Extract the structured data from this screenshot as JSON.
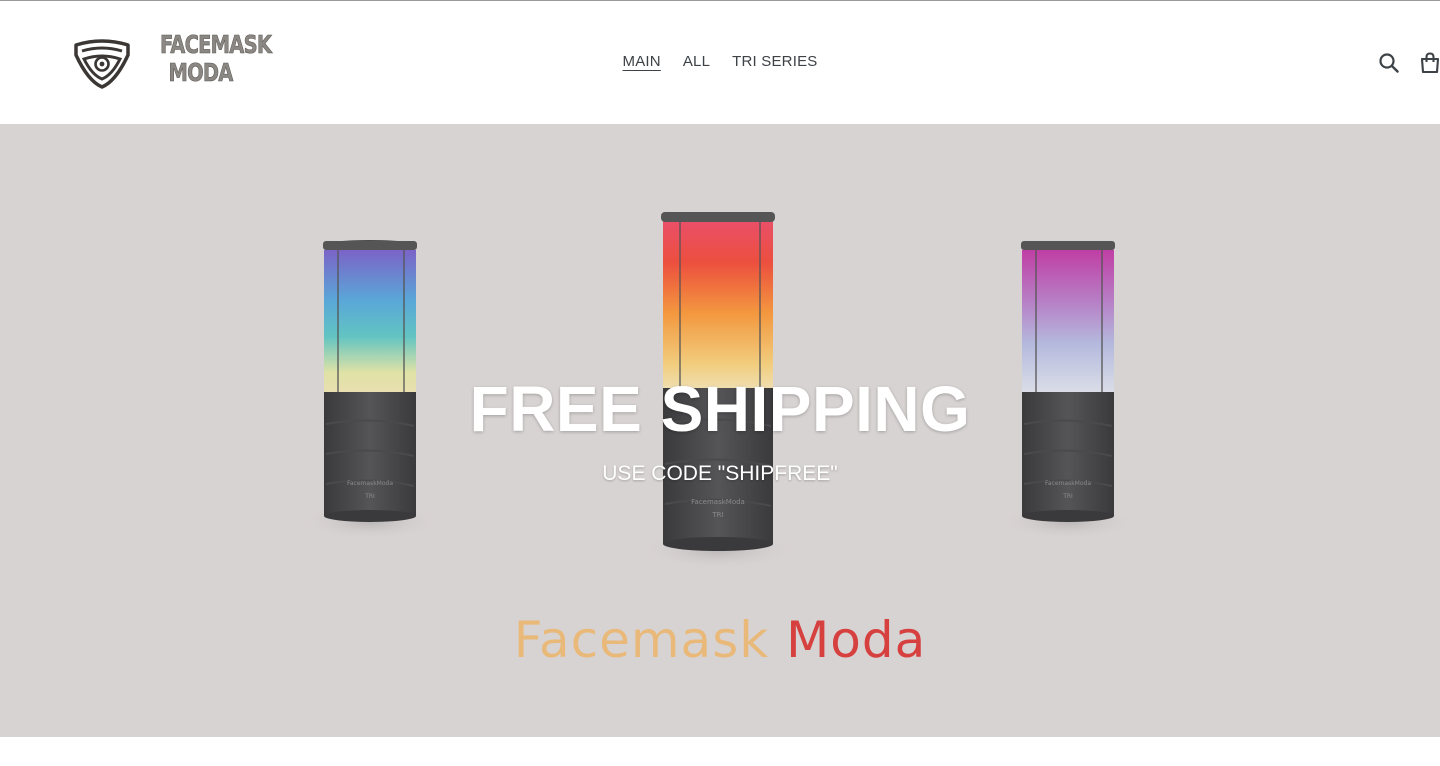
{
  "site": {
    "logo_line1": "FACEMASK",
    "logo_line2": "MODA"
  },
  "nav": {
    "items": [
      {
        "label": "MAIN",
        "active": true
      },
      {
        "label": "ALL",
        "active": false
      },
      {
        "label": "TRI SERIES",
        "active": false
      }
    ]
  },
  "header_icons": {
    "search": "search-icon",
    "cart": "cart-icon"
  },
  "hero": {
    "title": "FREE SHIPPING",
    "subtitle": "USE CODE \"SHIPFREE\"",
    "brand_word1": "Facemask",
    "brand_word2": "Moda",
    "product_label": "FacemaskModa",
    "product_tag": "TRI"
  },
  "colors": {
    "hero_bg": "#d8d3d3",
    "text": "#3d4246",
    "brand_orange": "#e9b97a",
    "brand_red": "#d6403e"
  }
}
